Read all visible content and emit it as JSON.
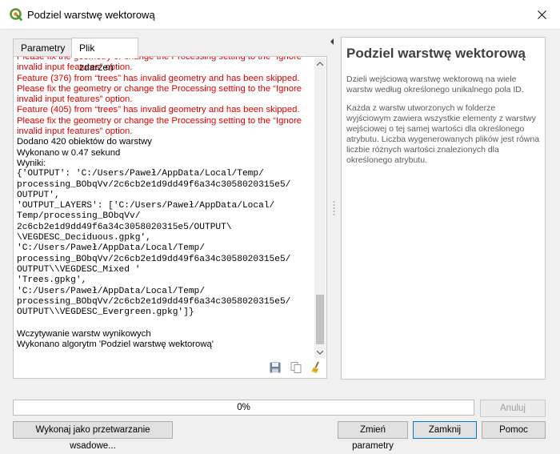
{
  "window": {
    "title": "Podziel warstwę wektorową"
  },
  "tabs": [
    {
      "label": "Parametry",
      "active": false
    },
    {
      "label": "Plik zdarzeń",
      "active": true
    }
  ],
  "log": {
    "lines": [
      {
        "text": "Please fix the geometry or change the Processing setting to the “Ignore",
        "style": "red"
      },
      {
        "text": "invalid input features” option.",
        "style": "red"
      },
      {
        "text": "Feature (376) from “trees” has invalid geometry and has been skipped.",
        "style": "red"
      },
      {
        "text": "Please fix the geometry or change the Processing setting to the “Ignore",
        "style": "red"
      },
      {
        "text": "invalid input features” option.",
        "style": "red"
      },
      {
        "text": "Feature (405) from “trees” has invalid geometry and has been skipped.",
        "style": "red"
      },
      {
        "text": "Please fix the geometry or change the Processing setting to the “Ignore",
        "style": "red"
      },
      {
        "text": "invalid input features” option.",
        "style": "red"
      },
      {
        "text": "Dodano 420 obiektów do warstwy",
        "style": "normal"
      },
      {
        "text": "Wykonano w 0.47 sekund",
        "style": "normal"
      },
      {
        "text": "Wyniki:",
        "style": "normal"
      },
      {
        "text": "{'OUTPUT': 'C:/Users/Paweł/AppData/Local/Temp/",
        "style": "mono"
      },
      {
        "text": "processing_BObqVv/2c6cb2e1d9dd49f6a34c3058020315e5/",
        "style": "mono"
      },
      {
        "text": "OUTPUT',",
        "style": "mono"
      },
      {
        "text": "'OUTPUT_LAYERS': ['C:/Users/Paweł/AppData/Local/",
        "style": "mono"
      },
      {
        "text": "Temp/processing_BObqVv/",
        "style": "mono"
      },
      {
        "text": "2c6cb2e1d9dd49f6a34c3058020315e5/OUTPUT\\",
        "style": "mono"
      },
      {
        "text": "\\VEGDESC_Deciduous.gpkg',",
        "style": "mono"
      },
      {
        "text": "'C:/Users/Paweł/AppData/Local/Temp/",
        "style": "mono"
      },
      {
        "text": "processing_BObqVv/2c6cb2e1d9dd49f6a34c3058020315e5/",
        "style": "mono"
      },
      {
        "text": "OUTPUT\\\\VEGDESC_Mixed '",
        "style": "mono"
      },
      {
        "text": "'Trees.gpkg',",
        "style": "mono"
      },
      {
        "text": "'C:/Users/Paweł/AppData/Local/Temp/",
        "style": "mono"
      },
      {
        "text": "processing_BObqVv/2c6cb2e1d9dd49f6a34c3058020315e5/",
        "style": "mono"
      },
      {
        "text": "OUTPUT\\\\VEGDESC_Evergreen.gpkg']}",
        "style": "mono"
      },
      {
        "text": " ",
        "style": "normal"
      },
      {
        "text": "Wczytywanie warstw wynikowych",
        "style": "normal"
      },
      {
        "text": "Wykonano algorytm 'Podziel warstwę wektorową'",
        "style": "normal"
      }
    ]
  },
  "help": {
    "title": "Podziel warstwę wektorową",
    "paragraphs": [
      "Dzieli wejściową warstwę wektorową na wiele warstw według określonego unikalnego pola ID.",
      "Każda z warstw utworzonych w folderze wyjściowym zawiera wszystkie elementy z warstwy wejściowej o tej samej wartości dla określonego atrybutu. Liczba wygenerowanych plików jest równa liczbie różnych wartości znalezionych dla określonego atrybutu."
    ]
  },
  "progress": {
    "value": 0,
    "label": "0%"
  },
  "buttons": {
    "cancel": "Anuluj",
    "batch": "Wykonaj jako przetwarzanie wsadowe...",
    "change_params": "Zmień parametry",
    "close": "Zamknij",
    "help": "Pomoc"
  },
  "colors": {
    "error_text": "#e30000",
    "progress_fill": "#06b025",
    "qgis_green": "#589632"
  }
}
